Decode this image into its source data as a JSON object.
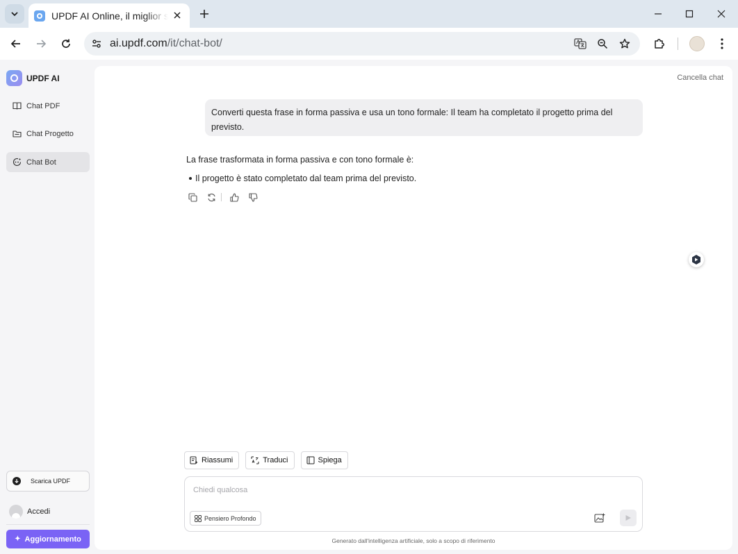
{
  "browser": {
    "tab_title": "UPDF AI Online, il miglior strumento di chat AI",
    "url_host": "ai.updf.com",
    "url_path": "/it/chat-bot/"
  },
  "sidebar": {
    "brand": "UPDF AI",
    "items": [
      {
        "label": "Chat PDF",
        "icon": "book-icon",
        "active": false
      },
      {
        "label": "Chat Progetto",
        "icon": "folder-icon",
        "active": false
      },
      {
        "label": "Chat Bot",
        "icon": "bot-icon",
        "active": true
      }
    ],
    "download_label": "Scarica UPDF",
    "login_label": "Accedi",
    "upgrade_label": "Aggiornamento"
  },
  "chat": {
    "clear_label": "Cancella chat",
    "user_message": "Converti questa frase in forma passiva e usa un tono formale: Il team ha completato il progetto prima del previsto.",
    "answer_intro": "La frase trasformata in forma passiva e con tono formale è:",
    "answer_bullet": "Il progetto è stato completato dal team prima del previsto."
  },
  "quick_actions": [
    {
      "label": "Riassumi",
      "icon": "summary-icon"
    },
    {
      "label": "Traduci",
      "icon": "translate-icon"
    },
    {
      "label": "Spiega",
      "icon": "book-open-icon"
    }
  ],
  "composer": {
    "placeholder": "Chiedi qualcosa",
    "deep_think_label": "Pensiero Profondo",
    "disclaimer": "Generato dall'intelligenza artificiale, solo a scopo di riferimento"
  },
  "colors": {
    "accent": "#7a63f5",
    "tabstrip": "#dfe7ef",
    "sidebar_bg": "#f5f5f7"
  }
}
